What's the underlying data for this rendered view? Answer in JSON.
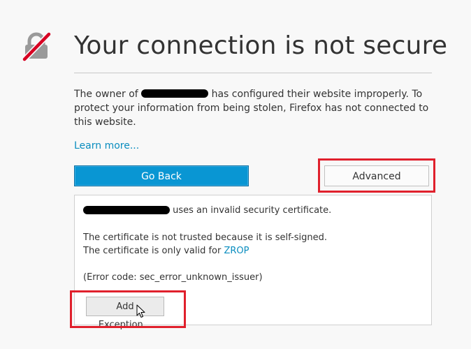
{
  "page": {
    "title": "Your connection is not secure",
    "description_prefix": "The owner of",
    "description_suffix": "has configured their website improperly. To protect your information from being stolen, Firefox has not connected to this website.",
    "learn_more": "Learn more..."
  },
  "buttons": {
    "go_back": "Go Back",
    "advanced": "Advanced",
    "add_exception": "Add Exception..."
  },
  "advanced_panel": {
    "invalid_cert_suffix": "uses an invalid security certificate.",
    "not_trusted": "The certificate is not trusted because it is self-signed.",
    "only_valid_prefix": "The certificate is only valid for",
    "valid_domain": "ZROP",
    "error_code": "(Error code: sec_error_unknown_issuer)"
  },
  "icons": {
    "lock": "crossed-lock-icon",
    "cursor": "mouse-pointer-icon"
  },
  "colors": {
    "background": "#f8f8f8",
    "primary_button": "#0996d3",
    "link": "#0a8dbf",
    "highlight": "#e0202c",
    "lock_gray": "#9a9a9a",
    "slash_red": "#d70022"
  }
}
